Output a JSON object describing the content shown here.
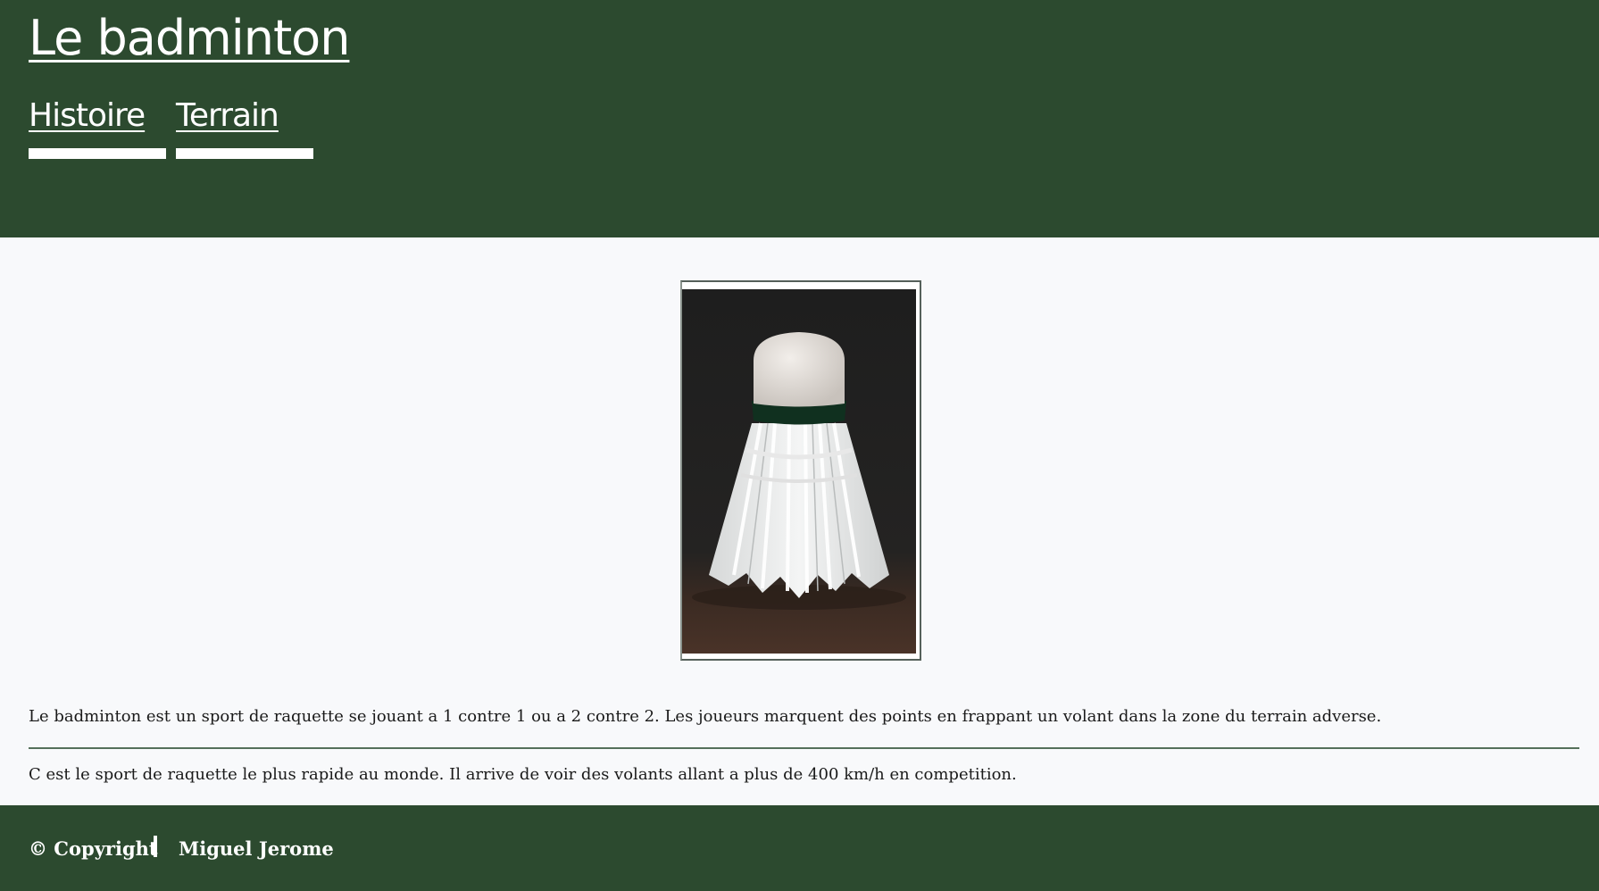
{
  "header": {
    "title": "Le badminton",
    "nav": [
      {
        "label": "Histoire"
      },
      {
        "label": "Terrain"
      }
    ]
  },
  "main": {
    "image_subject": "shuttlecock-photo",
    "paragraphs": [
      "Le badminton est un sport de raquette se jouant a 1 contre 1 ou a 2 contre 2. Les joueurs marquent des points en frappant un volant dans la zone du terrain adverse.",
      "C est le sport de raquette le plus rapide au monde. Il arrive de voir des volants allant a plus de 400 km/h en competition."
    ]
  },
  "footer": {
    "copyright": "© Copyright",
    "author": "Miguel Jerome"
  },
  "colors": {
    "primary": "#2c4a2f",
    "background": "#f8f9fb",
    "text": "#1a1a1a"
  }
}
